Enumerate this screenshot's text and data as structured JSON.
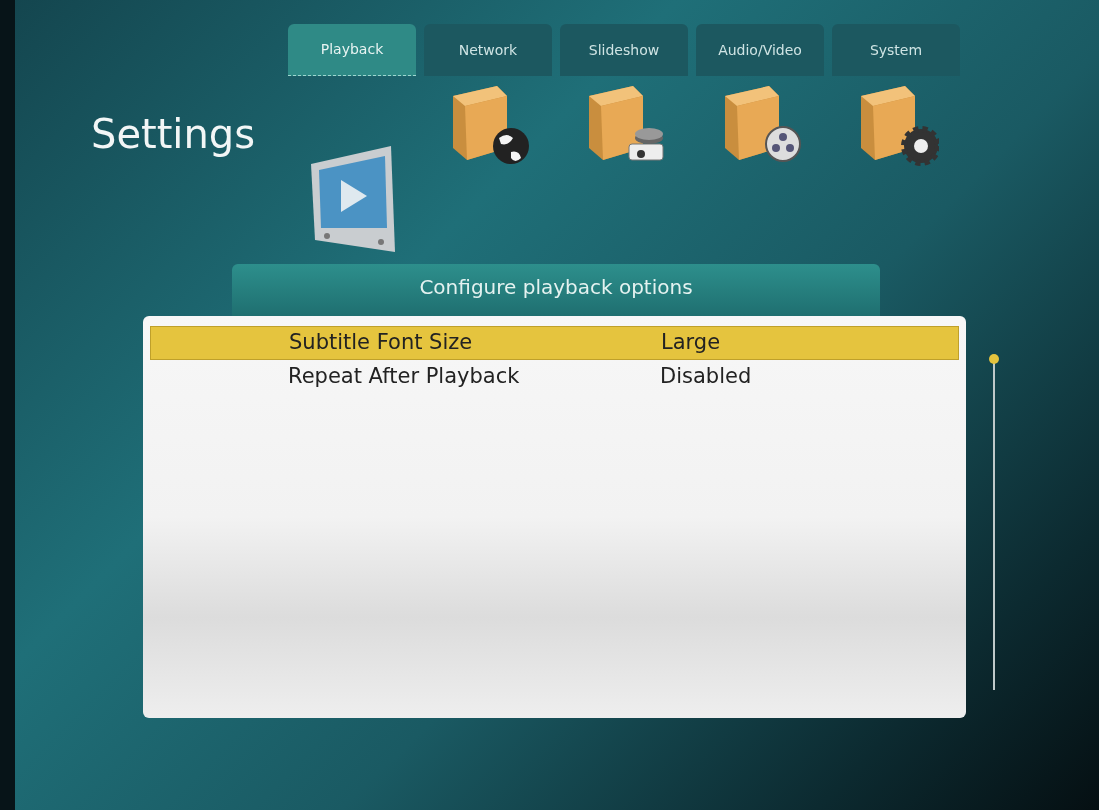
{
  "title": "Settings",
  "tabs": [
    {
      "label": "Playback",
      "kind": "playback",
      "selected": true
    },
    {
      "label": "Network",
      "kind": "network",
      "selected": false
    },
    {
      "label": "Slideshow",
      "kind": "slideshow",
      "selected": false
    },
    {
      "label": "Audio/Video",
      "kind": "audio_video",
      "selected": false
    },
    {
      "label": "System",
      "kind": "system",
      "selected": false
    }
  ],
  "panel_title": "Configure playback options",
  "options": [
    {
      "label": "Subtitle Font Size",
      "value": "Large",
      "selected": true
    },
    {
      "label": "Repeat After Playback",
      "value": "Disabled",
      "selected": false
    }
  ]
}
